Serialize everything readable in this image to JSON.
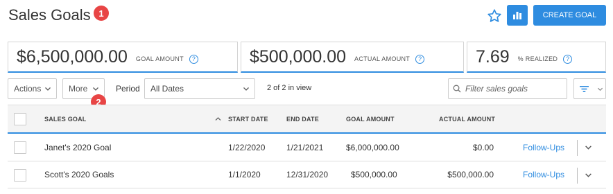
{
  "header": {
    "title": "Sales Goals",
    "badge_1": "1",
    "create_button": "CREATE GOAL"
  },
  "kpis": [
    {
      "value": "$6,500,000.00",
      "label": "GOAL AMOUNT",
      "help": "?"
    },
    {
      "value": "$500,000.00",
      "label": "ACTUAL AMOUNT",
      "help": "?"
    },
    {
      "value": "7.69",
      "label": "% REALIZED",
      "help": "?"
    }
  ],
  "toolbar": {
    "actions_label": "Actions",
    "more_label": "More",
    "badge_2": "2",
    "period_label": "Period",
    "period_value": "All Dates",
    "count_text": "2 of 2 in view",
    "search_placeholder": "Filter sales goals"
  },
  "table": {
    "columns": {
      "sales_goal": "SALES GOAL",
      "start_date": "START DATE",
      "end_date": "END DATE",
      "goal_amount": "GOAL AMOUNT",
      "actual_amount": "ACTUAL AMOUNT"
    },
    "rows": [
      {
        "name": "Janet's 2020 Goal",
        "start": "1/22/2020",
        "end": "1/21/2021",
        "goal": "$6,000,000.00",
        "actual": "$0.00",
        "action": "Follow-Ups"
      },
      {
        "name": "Scott's 2020 Goals",
        "start": "1/1/2020",
        "end": "12/31/2020",
        "goal": "$500,000.00",
        "actual": "$500,000.00",
        "action": "Follow-Ups"
      }
    ]
  },
  "icons": {
    "star": "star-outline-icon",
    "chart": "bar-chart-icon",
    "help": "question-circle-icon",
    "chevron": "chevron-down-icon",
    "search": "search-icon",
    "filter": "filter-icon",
    "sort": "sort-asc-icon"
  },
  "colors": {
    "accent": "#2e8ce0",
    "badge": "#e84545"
  }
}
